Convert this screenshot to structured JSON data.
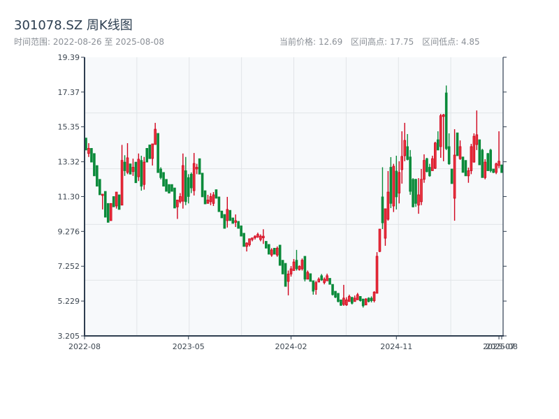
{
  "header": {
    "title": "301078.SZ 周K线图",
    "range_label": "时间范围: 2022-08-26 至 2025-08-08",
    "current_price": "当前价格: 12.69",
    "range_high": "区间高点: 17.75",
    "range_low": "区间低点: 4.85"
  },
  "chart_data": {
    "type": "candlestick",
    "title": "301078.SZ 周K线图",
    "period": "weekly",
    "start_date": "2022-08-26",
    "end_date": "2025-08-08",
    "ylim": [
      3.205,
      19.39
    ],
    "y_ticks": [
      "3.205",
      "5.229",
      "7.252",
      "9.276",
      "11.30",
      "13.32",
      "15.35",
      "17.37",
      "19.39"
    ],
    "x_ticks": [
      {
        "label": "2022-08",
        "index": 0
      },
      {
        "label": "2023-05",
        "index": 37
      },
      {
        "label": "2024-02",
        "index": 74
      },
      {
        "label": "2024-11",
        "index": 112
      },
      {
        "label": "2025-07",
        "index": 149
      },
      {
        "label": "2025-08",
        "index": 150
      }
    ],
    "grid": true,
    "colors": {
      "up": "#d0021b",
      "up_fill": "#e8353f",
      "down": "#0a8a3a",
      "axis": "#2f3e50",
      "grid": "#e1e4e8",
      "plot_bg": "#f7f9fb"
    },
    "ohlc_format": [
      "open",
      "high",
      "low",
      "close"
    ],
    "candles": [
      [
        14.7,
        14.7,
        14.0,
        14.0
      ],
      [
        13.8,
        14.4,
        13.6,
        14.1
      ],
      [
        14.1,
        14.1,
        13.3,
        13.3
      ],
      [
        13.8,
        13.8,
        12.5,
        12.5
      ],
      [
        13.1,
        13.1,
        11.9,
        11.9
      ],
      [
        12.3,
        12.3,
        11.4,
        11.4
      ],
      [
        11.36,
        11.44,
        10.55,
        11.44
      ],
      [
        11.6,
        11.6,
        10.1,
        10.1
      ],
      [
        10.9,
        10.9,
        9.8,
        9.8
      ],
      [
        9.9,
        10.9,
        9.9,
        10.9
      ],
      [
        11.3,
        11.3,
        10.7,
        10.7
      ],
      [
        10.75,
        11.56,
        10.6,
        11.56
      ],
      [
        11.4,
        11.4,
        10.55,
        10.55
      ],
      [
        10.8,
        14.3,
        10.8,
        13.4
      ],
      [
        13.3,
        13.7,
        12.5,
        12.8
      ],
      [
        12.7,
        14.4,
        12.6,
        13.55
      ],
      [
        13.2,
        13.2,
        12.6,
        12.6
      ],
      [
        12.75,
        13.5,
        12.5,
        13.0
      ],
      [
        13.3,
        13.3,
        12.1,
        12.1
      ],
      [
        12.45,
        13.8,
        12.2,
        13.47
      ],
      [
        13.4,
        13.67,
        11.64,
        11.9
      ],
      [
        12.0,
        13.6,
        11.7,
        13.3
      ],
      [
        14.1,
        14.1,
        13.3,
        13.3
      ],
      [
        14.3,
        14.3,
        13.5,
        13.5
      ],
      [
        13.51,
        14.36,
        13.1,
        14.36
      ],
      [
        14.32,
        15.58,
        14.32,
        15.21
      ],
      [
        14.97,
        14.97,
        12.69,
        12.69
      ],
      [
        12.9,
        13.0,
        12.3,
        12.4
      ],
      [
        12.7,
        12.7,
        11.9,
        11.9
      ],
      [
        12.3,
        12.3,
        11.6,
        11.6
      ],
      [
        12.0,
        12.0,
        11.5,
        11.5
      ],
      [
        12.0,
        12.0,
        11.6,
        11.6
      ],
      [
        11.8,
        11.8,
        10.63,
        10.63
      ],
      [
        10.7,
        11.1,
        10.0,
        11.1
      ],
      [
        11.0,
        11.5,
        10.9,
        11.3
      ],
      [
        11.03,
        13.8,
        10.6,
        13.1
      ],
      [
        12.8,
        13.6,
        10.8,
        11.0
      ],
      [
        12.4,
        12.6,
        10.9,
        11.3
      ],
      [
        12.6,
        12.7,
        11.5,
        11.8
      ],
      [
        11.64,
        13.83,
        11.36,
        13.22
      ],
      [
        12.9,
        13.2,
        12.6,
        13.0
      ],
      [
        13.5,
        13.5,
        12.6,
        12.6
      ],
      [
        12.66,
        12.66,
        11.28,
        11.28
      ],
      [
        11.64,
        11.64,
        10.87,
        10.87
      ],
      [
        10.9,
        11.4,
        10.9,
        11.1
      ],
      [
        11.0,
        11.5,
        10.8,
        11.3
      ],
      [
        10.9,
        11.56,
        10.75,
        11.4
      ],
      [
        11.7,
        11.7,
        11.2,
        11.2
      ],
      [
        11.28,
        11.28,
        10.42,
        10.42
      ],
      [
        10.46,
        10.46,
        10.06,
        10.06
      ],
      [
        10.26,
        10.26,
        9.45,
        9.45
      ],
      [
        9.9,
        11.28,
        9.5,
        10.55
      ],
      [
        10.5,
        10.5,
        9.9,
        9.9
      ],
      [
        10.06,
        10.06,
        9.74,
        9.74
      ],
      [
        9.8,
        10.26,
        9.53,
        9.9
      ],
      [
        9.86,
        9.86,
        9.45,
        9.45
      ],
      [
        9.6,
        9.6,
        9.0,
        9.0
      ],
      [
        9.17,
        9.17,
        8.4,
        8.4
      ],
      [
        8.4,
        8.64,
        8.11,
        8.6
      ],
      [
        8.5,
        8.85,
        8.4,
        8.85
      ],
      [
        8.8,
        8.9,
        8.7,
        8.9
      ],
      [
        8.9,
        9.05,
        8.8,
        9.0
      ],
      [
        8.95,
        9.2,
        8.9,
        9.1
      ],
      [
        8.8,
        9.1,
        8.7,
        9.0
      ],
      [
        8.9,
        9.4,
        8.55,
        9.0
      ],
      [
        8.7,
        8.7,
        8.3,
        8.3
      ],
      [
        8.52,
        8.52,
        7.95,
        7.95
      ],
      [
        7.9,
        8.3,
        7.8,
        8.2
      ],
      [
        8.3,
        8.3,
        7.95,
        7.95
      ],
      [
        7.9,
        8.4,
        7.8,
        8.3
      ],
      [
        8.48,
        8.48,
        7.3,
        7.3
      ],
      [
        7.6,
        7.6,
        6.8,
        6.8
      ],
      [
        7.42,
        7.42,
        6.08,
        6.08
      ],
      [
        6.37,
        7.0,
        5.56,
        6.8
      ],
      [
        6.8,
        7.26,
        6.65,
        7.1
      ],
      [
        7.0,
        7.67,
        7.0,
        7.5
      ],
      [
        7.6,
        8.2,
        7.0,
        7.1
      ],
      [
        7.05,
        7.3,
        7.0,
        7.25
      ],
      [
        7.1,
        7.7,
        7.0,
        7.6
      ],
      [
        7.83,
        7.83,
        6.37,
        6.5
      ],
      [
        6.5,
        7.0,
        6.5,
        6.9
      ],
      [
        6.82,
        6.82,
        6.37,
        6.37
      ],
      [
        6.41,
        6.41,
        5.6,
        5.8
      ],
      [
        5.9,
        6.4,
        5.6,
        6.3
      ],
      [
        6.33,
        6.6,
        6.33,
        6.5
      ],
      [
        6.7,
        6.8,
        6.4,
        6.45
      ],
      [
        6.3,
        6.6,
        6.2,
        6.5
      ],
      [
        6.4,
        6.82,
        6.4,
        6.7
      ],
      [
        6.55,
        6.55,
        6.2,
        6.2
      ],
      [
        6.2,
        6.2,
        5.55,
        5.6
      ],
      [
        5.8,
        5.8,
        5.4,
        5.45
      ],
      [
        5.68,
        5.68,
        5.15,
        5.2
      ],
      [
        5.3,
        5.3,
        4.95,
        4.98
      ],
      [
        5.03,
        6.17,
        4.95,
        5.4
      ],
      [
        5.0,
        5.45,
        4.95,
        5.3
      ],
      [
        5.2,
        5.6,
        5.2,
        5.5
      ],
      [
        5.45,
        5.45,
        5.03,
        5.1
      ],
      [
        5.2,
        5.55,
        5.2,
        5.4
      ],
      [
        5.3,
        5.7,
        5.3,
        5.6
      ],
      [
        5.5,
        5.5,
        5.2,
        5.25
      ],
      [
        5.35,
        5.35,
        4.85,
        4.95
      ],
      [
        5.0,
        5.4,
        5.0,
        5.35
      ],
      [
        5.4,
        5.45,
        5.15,
        5.2
      ],
      [
        5.4,
        5.5,
        5.15,
        5.25
      ],
      [
        5.25,
        5.8,
        5.15,
        5.75
      ],
      [
        5.68,
        8.07,
        5.68,
        7.83
      ],
      [
        8.11,
        9.41,
        8.07,
        9.41
      ],
      [
        11.28,
        13.0,
        9.41,
        9.77
      ],
      [
        8.88,
        10.59,
        8.44,
        10.59
      ],
      [
        9.98,
        12.78,
        9.9,
        11.56
      ],
      [
        13.0,
        13.59,
        10.63,
        10.9
      ],
      [
        10.75,
        13.2,
        10.4,
        13.06
      ],
      [
        12.78,
        13.67,
        10.55,
        11.28
      ],
      [
        11.5,
        13.35,
        10.9,
        12.7
      ],
      [
        12.86,
        15.09,
        12.05,
        13.63
      ],
      [
        13.67,
        15.58,
        13.35,
        14.56
      ],
      [
        14.2,
        14.93,
        13.4,
        13.45
      ],
      [
        13.6,
        14.0,
        11.4,
        11.6
      ],
      [
        12.3,
        12.37,
        10.67,
        10.7
      ],
      [
        12.3,
        12.33,
        10.7,
        10.9
      ],
      [
        10.8,
        12.37,
        10.3,
        11.4
      ],
      [
        11.0,
        12.9,
        10.8,
        12.3
      ],
      [
        12.3,
        13.75,
        12.1,
        13.4
      ],
      [
        13.5,
        13.55,
        12.7,
        12.75
      ],
      [
        13.0,
        13.2,
        12.45,
        12.5
      ],
      [
        12.8,
        13.67,
        12.8,
        13.5
      ],
      [
        12.94,
        14.48,
        12.9,
        14.41
      ],
      [
        14.6,
        15.09,
        14.0,
        14.0
      ],
      [
        14.2,
        16.1,
        13.55,
        16.0
      ],
      [
        15.95,
        16.1,
        13.35,
        16.05
      ],
      [
        17.32,
        17.75,
        14.0,
        14.08
      ],
      [
        14.2,
        14.97,
        13.14,
        13.2
      ],
      [
        12.9,
        12.9,
        12.05,
        12.05
      ],
      [
        11.2,
        15.21,
        9.9,
        13.71
      ],
      [
        15.0,
        15.0,
        13.67,
        13.67
      ],
      [
        13.5,
        14.56,
        13.43,
        14.2
      ],
      [
        13.6,
        13.6,
        12.7,
        12.7
      ],
      [
        13.4,
        13.4,
        12.5,
        12.5
      ],
      [
        12.5,
        12.98,
        12.1,
        12.8
      ],
      [
        12.8,
        14.36,
        12.6,
        14.2
      ],
      [
        13.3,
        14.97,
        13.27,
        14.8
      ],
      [
        14.32,
        16.3,
        14.0,
        14.89
      ],
      [
        14.6,
        14.6,
        13.14,
        13.14
      ],
      [
        14.0,
        14.07,
        12.4,
        12.4
      ],
      [
        12.4,
        13.47,
        12.3,
        13.3
      ],
      [
        13.8,
        13.83,
        12.78,
        12.8
      ],
      [
        14.0,
        14.07,
        12.7,
        12.8
      ],
      [
        12.9,
        12.9,
        12.66,
        12.7
      ],
      [
        12.7,
        13.27,
        12.6,
        13.2
      ],
      [
        13.1,
        15.09,
        12.95,
        13.35
      ],
      [
        13.14,
        13.14,
        12.69,
        12.69
      ]
    ]
  }
}
